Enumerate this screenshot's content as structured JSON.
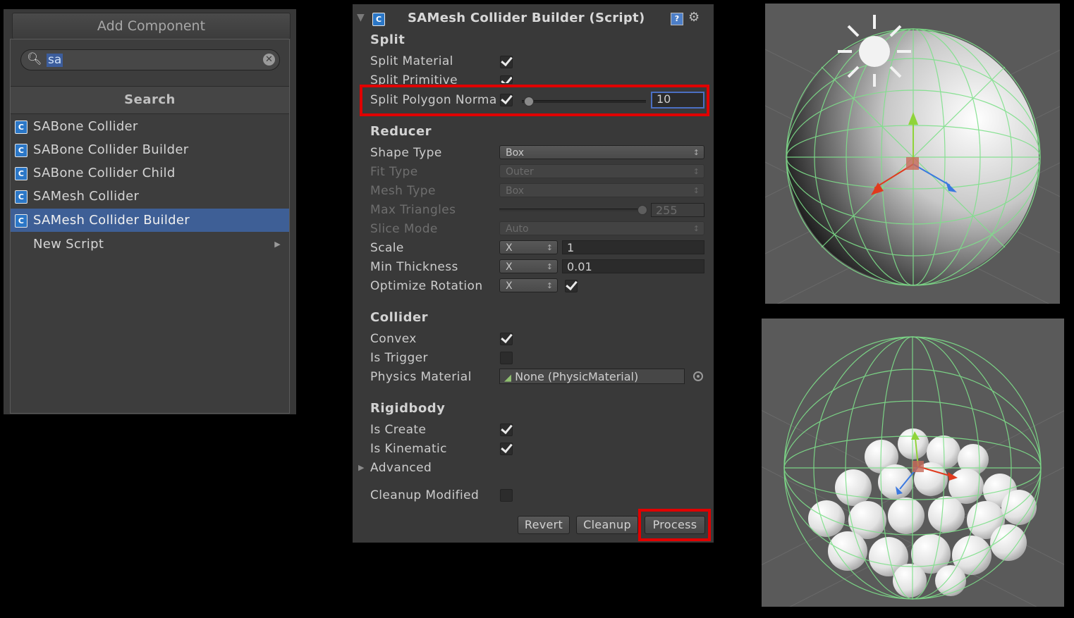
{
  "add_component": {
    "title": "Add Component",
    "search_value": "sa",
    "section_label": "Search",
    "items": [
      {
        "label": "SABone Collider",
        "selected": false
      },
      {
        "label": "SABone Collider Builder",
        "selected": false
      },
      {
        "label": "SABone Collider Child",
        "selected": false
      },
      {
        "label": "SAMesh Collider",
        "selected": false
      },
      {
        "label": "SAMesh Collider Builder",
        "selected": true
      }
    ],
    "new_script_label": "New Script"
  },
  "inspector": {
    "title": "SAMesh Collider Builder (Script)",
    "split": {
      "header": "Split",
      "split_material": {
        "label": "Split Material",
        "checked": true
      },
      "split_primitive": {
        "label": "Split Primitive",
        "checked": true
      },
      "split_polygon_normal": {
        "label": "Split Polygon Norma",
        "checked": true,
        "value": "10",
        "slider_fraction": 0.05
      }
    },
    "reducer": {
      "header": "Reducer",
      "shape_type": {
        "label": "Shape Type",
        "value": "Box"
      },
      "fit_type": {
        "label": "Fit Type",
        "value": "Outer"
      },
      "mesh_type": {
        "label": "Mesh Type",
        "value": "Box"
      },
      "max_triangles": {
        "label": "Max Triangles",
        "value": "255",
        "slider_fraction": 1.0
      },
      "slice_mode": {
        "label": "Slice Mode",
        "value": "Auto"
      },
      "scale": {
        "label": "Scale",
        "axis": "X",
        "value": "1"
      },
      "min_thickness": {
        "label": "Min Thickness",
        "axis": "X",
        "value": "0.01"
      },
      "optimize_rotation": {
        "label": "Optimize Rotation",
        "axis": "X",
        "checked": true
      }
    },
    "collider": {
      "header": "Collider",
      "convex": {
        "label": "Convex",
        "checked": true
      },
      "is_trigger": {
        "label": "Is Trigger",
        "checked": false
      },
      "physics_material": {
        "label": "Physics Material",
        "value": "None (PhysicMaterial)"
      }
    },
    "rigidbody": {
      "header": "Rigidbody",
      "is_create": {
        "label": "Is Create",
        "checked": true
      },
      "is_kinematic": {
        "label": "Is Kinematic",
        "checked": true
      }
    },
    "advanced_label": "Advanced",
    "cleanup_modified": {
      "label": "Cleanup Modified",
      "checked": false
    },
    "buttons": {
      "revert": "Revert",
      "cleanup": "Cleanup",
      "process": "Process"
    }
  },
  "colors": {
    "panel_bg": "#393939",
    "selection": "#3e5f96",
    "highlight": "#e00000",
    "wireframe": "#7ee08a",
    "viewport_bg": "#5a5a5a"
  }
}
